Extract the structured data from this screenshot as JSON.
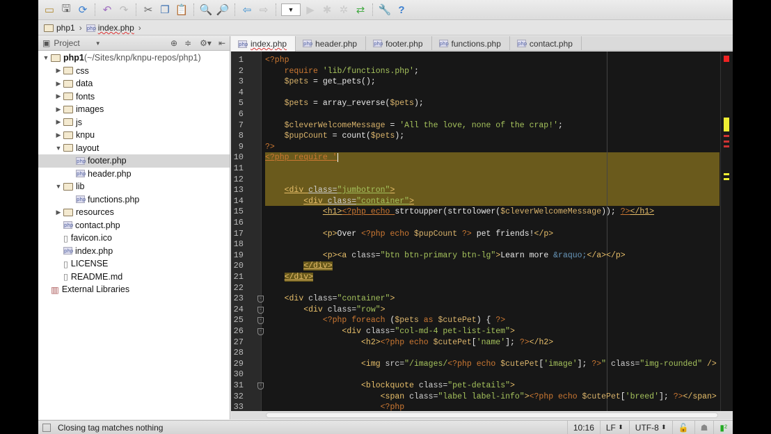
{
  "toolbar": {
    "icons": [
      "open-folder-icon",
      "save-icon",
      "sync-icon",
      "undo-icon",
      "redo-icon",
      "cut-icon",
      "copy-icon",
      "paste-icon",
      "find-icon",
      "replace-icon",
      "back-icon",
      "forward-icon",
      "run-config-dropdown",
      "run-icon",
      "debug-icon",
      "coverage-icon",
      "vcs-icon",
      "settings-icon",
      "help-icon"
    ]
  },
  "breadcrumb": [
    "php1",
    "index.php"
  ],
  "project_panel": {
    "title": "Project"
  },
  "tree": [
    {
      "depth": 0,
      "arrow": "open",
      "icon": "folder",
      "label": "php1",
      "suffix": " (~/Sites/knp/knpu-repos/php1)"
    },
    {
      "depth": 1,
      "arrow": "closed",
      "icon": "folder",
      "label": "css"
    },
    {
      "depth": 1,
      "arrow": "closed",
      "icon": "folder",
      "label": "data"
    },
    {
      "depth": 1,
      "arrow": "closed",
      "icon": "folder",
      "label": "fonts"
    },
    {
      "depth": 1,
      "arrow": "closed",
      "icon": "folder",
      "label": "images"
    },
    {
      "depth": 1,
      "arrow": "closed",
      "icon": "folder",
      "label": "js"
    },
    {
      "depth": 1,
      "arrow": "closed",
      "icon": "folder",
      "label": "knpu"
    },
    {
      "depth": 1,
      "arrow": "open",
      "icon": "folder",
      "label": "layout"
    },
    {
      "depth": 2,
      "arrow": "",
      "icon": "php",
      "label": "footer.php",
      "selected": true
    },
    {
      "depth": 2,
      "arrow": "",
      "icon": "php",
      "label": "header.php"
    },
    {
      "depth": 1,
      "arrow": "open",
      "icon": "folder",
      "label": "lib"
    },
    {
      "depth": 2,
      "arrow": "",
      "icon": "php",
      "label": "functions.php"
    },
    {
      "depth": 1,
      "arrow": "closed",
      "icon": "folder",
      "label": "resources"
    },
    {
      "depth": 1,
      "arrow": "",
      "icon": "php",
      "label": "contact.php"
    },
    {
      "depth": 1,
      "arrow": "",
      "icon": "file",
      "label": "favicon.ico"
    },
    {
      "depth": 1,
      "arrow": "",
      "icon": "php",
      "label": "index.php"
    },
    {
      "depth": 1,
      "arrow": "",
      "icon": "file",
      "label": "LICENSE"
    },
    {
      "depth": 1,
      "arrow": "",
      "icon": "file",
      "label": "README.md"
    },
    {
      "depth": 0,
      "arrow": "",
      "icon": "library",
      "label": "External Libraries"
    }
  ],
  "tabs": [
    {
      "label": "index.php",
      "active": true
    },
    {
      "label": "header.php"
    },
    {
      "label": "footer.php"
    },
    {
      "label": "functions.php"
    },
    {
      "label": "contact.php"
    }
  ],
  "code": [
    [
      [
        "k",
        "<?php"
      ]
    ],
    [
      [
        "p",
        "    "
      ],
      [
        "k",
        "require "
      ],
      [
        "s",
        "'lib/functions.php'"
      ],
      [
        "p",
        ";"
      ]
    ],
    [
      [
        "p",
        "    "
      ],
      [
        "v",
        "$pets"
      ],
      [
        "p",
        " = get_pets();"
      ]
    ],
    [],
    [
      [
        "p",
        "    "
      ],
      [
        "v",
        "$pets"
      ],
      [
        "p",
        " = array_reverse("
      ],
      [
        "v",
        "$pets"
      ],
      [
        "p",
        ");"
      ]
    ],
    [],
    [
      [
        "p",
        "    "
      ],
      [
        "v",
        "$cleverWelcomeMessage"
      ],
      [
        "p",
        " = "
      ],
      [
        "s",
        "'All the love, none of the crap!'"
      ],
      [
        "p",
        ";"
      ]
    ],
    [
      [
        "p",
        "    "
      ],
      [
        "v",
        "$pupCount"
      ],
      [
        "p",
        " = count("
      ],
      [
        "v",
        "$pets"
      ],
      [
        "p",
        ");"
      ]
    ],
    [
      [
        "k",
        "?>"
      ]
    ],
    [
      [
        "k",
        "<?php require '"
      ]
    ],
    [],
    [],
    [
      [
        "p",
        "    "
      ],
      [
        "t",
        "<div "
      ],
      [
        "a",
        "class="
      ],
      [
        "s",
        "\"jumbotron\""
      ],
      [
        "t",
        ">"
      ]
    ],
    [
      [
        "p",
        "        "
      ],
      [
        "t",
        "<div "
      ],
      [
        "a",
        "class="
      ],
      [
        "s",
        "\"container\""
      ],
      [
        "t",
        ">"
      ]
    ],
    [
      [
        "p",
        "            "
      ],
      [
        "t",
        "<h1>"
      ],
      [
        "k",
        "<?php echo "
      ],
      [
        "p",
        "strtoupper(strtolower("
      ],
      [
        "v",
        "$cleverWelcomeMessage"
      ],
      [
        "p",
        ")); "
      ],
      [
        "k",
        "?>"
      ],
      [
        "t",
        "</h1>"
      ]
    ],
    [],
    [
      [
        "p",
        "            "
      ],
      [
        "t",
        "<p>"
      ],
      [
        "p",
        "Over "
      ],
      [
        "k",
        "<?php echo "
      ],
      [
        "v",
        "$pupCount"
      ],
      [
        "k",
        " ?>"
      ],
      [
        "p",
        " pet friends!"
      ],
      [
        "t",
        "</p>"
      ]
    ],
    [],
    [
      [
        "p",
        "            "
      ],
      [
        "t",
        "<p><a "
      ],
      [
        "a",
        "class="
      ],
      [
        "s",
        "\"btn btn-primary btn-lg\""
      ],
      [
        "t",
        ">"
      ],
      [
        "p",
        "Learn more "
      ],
      [
        "e",
        "&raquo;"
      ],
      [
        "t",
        "</a></p>"
      ]
    ],
    [
      [
        "p",
        "        "
      ],
      [
        "m",
        "</div>"
      ]
    ],
    [
      [
        "p",
        "    "
      ],
      [
        "m",
        "</div>"
      ]
    ],
    [],
    [
      [
        "p",
        "    "
      ],
      [
        "t",
        "<div "
      ],
      [
        "a",
        "class="
      ],
      [
        "s",
        "\"container\""
      ],
      [
        "t",
        ">"
      ]
    ],
    [
      [
        "p",
        "        "
      ],
      [
        "t",
        "<div "
      ],
      [
        "a",
        "class="
      ],
      [
        "s",
        "\"row\""
      ],
      [
        "t",
        ">"
      ]
    ],
    [
      [
        "p",
        "            "
      ],
      [
        "k",
        "<?php foreach "
      ],
      [
        "p",
        "("
      ],
      [
        "v",
        "$pets"
      ],
      [
        "k",
        " as "
      ],
      [
        "v",
        "$cutePet"
      ],
      [
        "p",
        ") { "
      ],
      [
        "k",
        "?>"
      ]
    ],
    [
      [
        "p",
        "                "
      ],
      [
        "t",
        "<div "
      ],
      [
        "a",
        "class="
      ],
      [
        "s",
        "\"col-md-4 pet-list-item\""
      ],
      [
        "t",
        ">"
      ]
    ],
    [
      [
        "p",
        "                    "
      ],
      [
        "t",
        "<h2>"
      ],
      [
        "k",
        "<?php echo "
      ],
      [
        "v",
        "$cutePet"
      ],
      [
        "p",
        "["
      ],
      [
        "s",
        "'name'"
      ],
      [
        "p",
        "]; "
      ],
      [
        "k",
        "?>"
      ],
      [
        "t",
        "</h2>"
      ]
    ],
    [],
    [
      [
        "p",
        "                    "
      ],
      [
        "t",
        "<img "
      ],
      [
        "a",
        "src="
      ],
      [
        "s",
        "\"/images/"
      ],
      [
        "k",
        "<?php echo "
      ],
      [
        "v",
        "$cutePet"
      ],
      [
        "p",
        "["
      ],
      [
        "s",
        "'image'"
      ],
      [
        "p",
        "]; "
      ],
      [
        "k",
        "?>"
      ],
      [
        "s",
        "\""
      ],
      [
        "a",
        " class="
      ],
      [
        "s",
        "\"img-rounded\""
      ],
      [
        "t",
        " />"
      ]
    ],
    [],
    [
      [
        "p",
        "                    "
      ],
      [
        "t",
        "<blockquote "
      ],
      [
        "a",
        "class="
      ],
      [
        "s",
        "\"pet-details\""
      ],
      [
        "t",
        ">"
      ]
    ],
    [
      [
        "p",
        "                        "
      ],
      [
        "t",
        "<span "
      ],
      [
        "a",
        "class="
      ],
      [
        "s",
        "\"label label-info\""
      ],
      [
        "t",
        ">"
      ],
      [
        "k",
        "<?php echo "
      ],
      [
        "v",
        "$cutePet"
      ],
      [
        "p",
        "["
      ],
      [
        "s",
        "'breed'"
      ],
      [
        "p",
        "]; "
      ],
      [
        "k",
        "?>"
      ],
      [
        "t",
        "</span>"
      ]
    ],
    [
      [
        "p",
        "                        "
      ],
      [
        "k",
        "<?php"
      ]
    ]
  ],
  "fold_lines": [
    23,
    24,
    25,
    26,
    31
  ],
  "status": {
    "message": "Closing tag matches nothing",
    "position": "10:16",
    "line_sep": "LF",
    "encoding": "UTF-8"
  },
  "colors": {
    "editor_bg": "#171717",
    "highlight": "#6a5a1c",
    "tag": "#e8bf6a",
    "string": "#a5c25c",
    "keyword": "#cc7832"
  }
}
